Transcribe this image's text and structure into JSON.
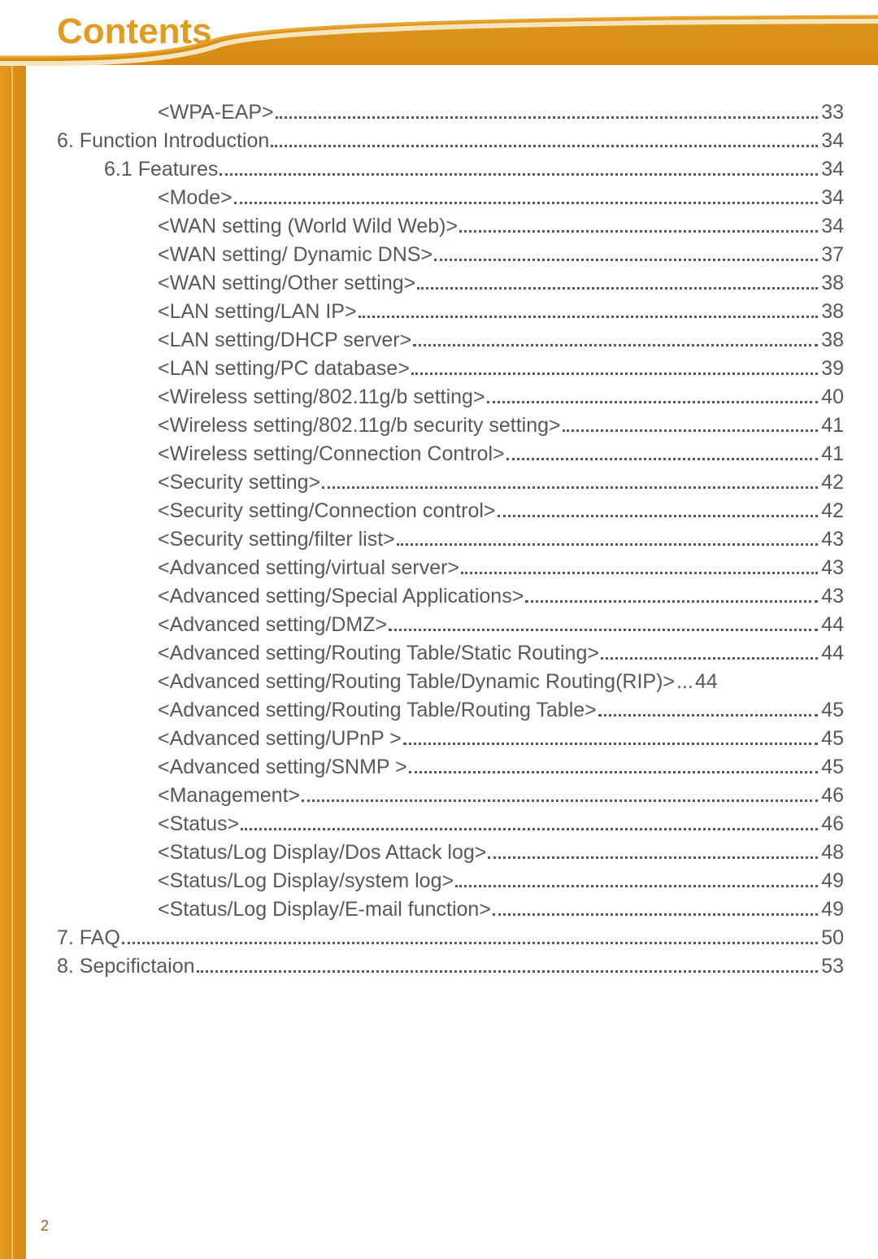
{
  "header": {
    "title": "Contents"
  },
  "page_number": "2",
  "toc": [
    {
      "indent": 3,
      "label": "<WPA-EAP>",
      "page": "33"
    },
    {
      "indent": 1,
      "label": "6. Function Introduction",
      "page": "34"
    },
    {
      "indent": 2,
      "label": "6.1 Features",
      "page": "34"
    },
    {
      "indent": 3,
      "label": "<Mode>",
      "page": "34"
    },
    {
      "indent": 3,
      "label": "<WAN setting (World Wild Web)>",
      "page": "34"
    },
    {
      "indent": 3,
      "label": "<WAN setting/ Dynamic DNS>",
      "page": "37"
    },
    {
      "indent": 3,
      "label": "<WAN setting/Other setting>",
      "page": "38"
    },
    {
      "indent": 3,
      "label": "<LAN setting/LAN IP>",
      "page": "38"
    },
    {
      "indent": 3,
      "label": "<LAN setting/DHCP server>",
      "page": "38"
    },
    {
      "indent": 3,
      "label": "<LAN setting/PC database>",
      "page": "39"
    },
    {
      "indent": 3,
      "label": "<Wireless setting/802.11g/b setting>",
      "page": "40"
    },
    {
      "indent": 3,
      "label": "<Wireless setting/802.11g/b security setting>",
      "page": "41"
    },
    {
      "indent": 3,
      "label": "<Wireless setting/Connection Control>",
      "page": "41"
    },
    {
      "indent": 3,
      "label": "<Security setting>",
      "page": "42"
    },
    {
      "indent": 3,
      "label": "<Security setting/Connection control>",
      "page": "42"
    },
    {
      "indent": 3,
      "label": "<Security setting/filter list>",
      "page": "43"
    },
    {
      "indent": 3,
      "label": "<Advanced setting/virtual server>",
      "page": "43"
    },
    {
      "indent": 3,
      "label": "<Advanced setting/Special Applications>",
      "page": "43"
    },
    {
      "indent": 3,
      "label": "<Advanced setting/DMZ>",
      "page": "44"
    },
    {
      "indent": 3,
      "label": "<Advanced setting/Routing Table/Static Routing>",
      "page": "44"
    },
    {
      "indent": 3,
      "label": "<Advanced setting/Routing Table/Dynamic Routing(RIP)>",
      "page": "44",
      "nodots": true
    },
    {
      "indent": 3,
      "label": "<Advanced setting/Routing Table/Routing Table>",
      "page": "45"
    },
    {
      "indent": 3,
      "label": "<Advanced setting/UPnP >",
      "page": "45"
    },
    {
      "indent": 3,
      "label": "<Advanced setting/SNMP >",
      "page": "45"
    },
    {
      "indent": 3,
      "label": "<Management>",
      "page": "46"
    },
    {
      "indent": 3,
      "label": "<Status>",
      "page": "46"
    },
    {
      "indent": 3,
      "label": "<Status/Log Display/Dos Attack log>",
      "page": "48"
    },
    {
      "indent": 3,
      "label": "<Status/Log Display/system log>",
      "page": "49"
    },
    {
      "indent": 3,
      "label": "<Status/Log Display/E-mail function>",
      "page": "49"
    },
    {
      "indent": 1,
      "label": "7. FAQ",
      "page": "50"
    },
    {
      "indent": 1,
      "label": "8. Sepcifictaion",
      "page": " 53"
    }
  ]
}
